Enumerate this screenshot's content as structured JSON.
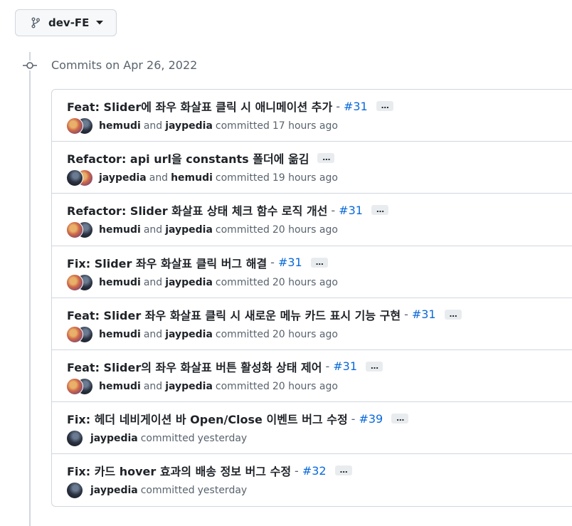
{
  "branch": {
    "name": "dev-FE"
  },
  "group": {
    "title": "Commits on Apr 26, 2022"
  },
  "commits": [
    {
      "title": "Feat: Slider에 좌우 화살표 클릭 시 애니메이션 추가",
      "pr": "#31",
      "authors": [
        "hemudi",
        "jaypedia"
      ],
      "joiner": "and",
      "verb": "committed",
      "time": "17 hours ago"
    },
    {
      "title": "Refactor: api url을 constants 폴더에 옮김",
      "pr": "",
      "authors": [
        "jaypedia",
        "hemudi"
      ],
      "joiner": "and",
      "verb": "committed",
      "time": "19 hours ago"
    },
    {
      "title": "Refactor: Slider 화살표 상태 체크 함수 로직 개선",
      "pr": "#31",
      "authors": [
        "hemudi",
        "jaypedia"
      ],
      "joiner": "and",
      "verb": "committed",
      "time": "20 hours ago"
    },
    {
      "title": "Fix: Slider 좌우 화살표 클릭 버그 해결",
      "pr": "#31",
      "authors": [
        "hemudi",
        "jaypedia"
      ],
      "joiner": "and",
      "verb": "committed",
      "time": "20 hours ago"
    },
    {
      "title": "Feat: Slider 좌우 화살표 클릭 시 새로운 메뉴 카드 표시 기능 구현",
      "pr": "#31",
      "authors": [
        "hemudi",
        "jaypedia"
      ],
      "joiner": "and",
      "verb": "committed",
      "time": "20 hours ago"
    },
    {
      "title": "Feat: Slider의 좌우 화살표 버튼 활성화 상태 제어",
      "pr": "#31",
      "authors": [
        "hemudi",
        "jaypedia"
      ],
      "joiner": "and",
      "verb": "committed",
      "time": "20 hours ago"
    },
    {
      "title": "Fix: 헤더 네비게이션 바 Open/Close 이벤트 버그 수정",
      "pr": "#39",
      "authors": [
        "jaypedia"
      ],
      "joiner": "",
      "verb": "committed",
      "time": "yesterday"
    },
    {
      "title": "Fix: 카드 hover 효과의 배송 정보 버그 수정",
      "pr": "#32",
      "authors": [
        "jaypedia"
      ],
      "joiner": "",
      "verb": "committed",
      "time": "yesterday"
    }
  ],
  "ui": {
    "separator": "-",
    "ellipsis": "…"
  },
  "icons": {
    "branch": "git-branch-icon",
    "caret": "triangle-down-icon",
    "commit_node": "git-commit-icon"
  },
  "colors": {
    "link": "#0969da",
    "muted": "#59636e",
    "border": "#d0d7de"
  }
}
